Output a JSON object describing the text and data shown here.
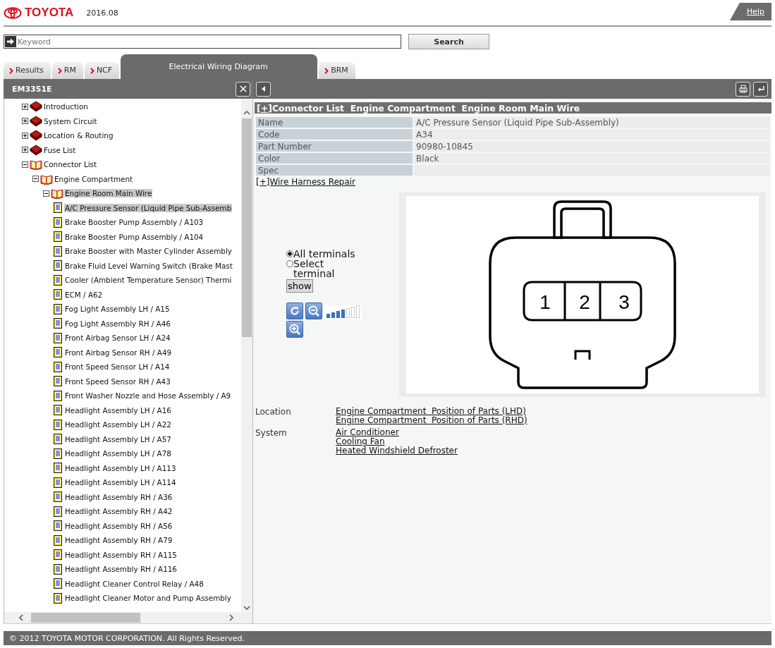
{
  "header": {
    "brand": "TOYOTA",
    "version": "2016.08",
    "help": "Help"
  },
  "search": {
    "placeholder": "Keyword",
    "button": "Search"
  },
  "tabs": [
    {
      "label": "Results",
      "selected": false
    },
    {
      "label": "RM",
      "selected": false
    },
    {
      "label": "NCF",
      "selected": false
    },
    {
      "label": "Electrical Wiring Diagram",
      "selected": true
    },
    {
      "label": "BRM",
      "selected": false
    }
  ],
  "left_panel": {
    "title": "EM3351E"
  },
  "tree": [
    {
      "label": "Introduction",
      "kind": "book",
      "expanded": false,
      "selected": false
    },
    {
      "label": "System Circuit",
      "kind": "book",
      "expanded": false,
      "selected": false
    },
    {
      "label": "Location & Routing",
      "kind": "book",
      "expanded": false,
      "selected": false
    },
    {
      "label": "Fuse List",
      "kind": "book",
      "expanded": false,
      "selected": false
    },
    {
      "label": "Connector List",
      "kind": "book",
      "expanded": true,
      "selected": false,
      "children": [
        {
          "label": "Engine Compartment",
          "kind": "book",
          "expanded": true,
          "selected": false,
          "children": [
            {
              "label": "Engine Room Main Wire",
              "kind": "book",
              "expanded": true,
              "selected": true,
              "children": [
                {
                  "label": "A/C Pressure Sensor (Liquid Pipe Sub-Assemb",
                  "kind": "page",
                  "selected": true
                },
                {
                  "label": "Brake Booster Pump Assembly / A103",
                  "kind": "page",
                  "selected": false
                },
                {
                  "label": "Brake Booster Pump Assembly / A104",
                  "kind": "page",
                  "selected": false
                },
                {
                  "label": "Brake Booster with Master Cylinder Assembly",
                  "kind": "page",
                  "selected": false
                },
                {
                  "label": "Brake Fluid Level Warning Switch (Brake Mast",
                  "kind": "page",
                  "selected": false
                },
                {
                  "label": "Cooler (Ambient Temperature Sensor) Thermi",
                  "kind": "page",
                  "selected": false
                },
                {
                  "label": "ECM / A62",
                  "kind": "page",
                  "selected": false
                },
                {
                  "label": "Fog Light Assembly LH / A15",
                  "kind": "page",
                  "selected": false
                },
                {
                  "label": "Fog Light Assembly RH / A46",
                  "kind": "page",
                  "selected": false
                },
                {
                  "label": "Front Airbag Sensor LH / A24",
                  "kind": "page",
                  "selected": false
                },
                {
                  "label": "Front Airbag Sensor RH / A49",
                  "kind": "page",
                  "selected": false
                },
                {
                  "label": "Front Speed Sensor LH / A14",
                  "kind": "page",
                  "selected": false
                },
                {
                  "label": "Front Speed Sensor RH / A43",
                  "kind": "page",
                  "selected": false
                },
                {
                  "label": "Front Washer Nozzle and Hose Assembly / A9",
                  "kind": "page",
                  "selected": false
                },
                {
                  "label": "Headlight Assembly LH / A16",
                  "kind": "page",
                  "selected": false
                },
                {
                  "label": "Headlight Assembly LH / A22",
                  "kind": "page",
                  "selected": false
                },
                {
                  "label": "Headlight Assembly LH / A57",
                  "kind": "page",
                  "selected": false
                },
                {
                  "label": "Headlight Assembly LH / A78",
                  "kind": "page",
                  "selected": false
                },
                {
                  "label": "Headlight Assembly LH / A113",
                  "kind": "page",
                  "selected": false
                },
                {
                  "label": "Headlight Assembly LH / A114",
                  "kind": "page",
                  "selected": false
                },
                {
                  "label": "Headlight Assembly RH / A36",
                  "kind": "page",
                  "selected": false
                },
                {
                  "label": "Headlight Assembly RH / A42",
                  "kind": "page",
                  "selected": false
                },
                {
                  "label": "Headlight Assembly RH / A56",
                  "kind": "page",
                  "selected": false
                },
                {
                  "label": "Headlight Assembly RH / A79",
                  "kind": "page",
                  "selected": false
                },
                {
                  "label": "Headlight Assembly RH / A115",
                  "kind": "page",
                  "selected": false
                },
                {
                  "label": "Headlight Assembly RH / A116",
                  "kind": "page",
                  "selected": false
                },
                {
                  "label": "Headlight Cleaner Control Relay / A48",
                  "kind": "page",
                  "selected": false
                },
                {
                  "label": "Headlight Cleaner Motor and Pump Assembly",
                  "kind": "page",
                  "selected": false
                }
              ]
            }
          ]
        }
      ]
    }
  ],
  "content": {
    "toggle": "[+]",
    "title": "Connector List  Engine Compartment  Engine Room Main Wire",
    "properties": [
      {
        "label": "Name",
        "value": "A/C Pressure Sensor (Liquid Pipe Sub-Assembly)"
      },
      {
        "label": "Code",
        "value": "A34"
      },
      {
        "label": "Part Number",
        "value": "90980-10845"
      },
      {
        "label": "Color",
        "value": "Black"
      },
      {
        "label": "Spec"
      }
    ],
    "repair_link": "[+]Wire Harness Repair",
    "terminal_options": [
      {
        "label": "All terminals",
        "selected": true
      },
      {
        "label": "Select terminal",
        "selected": false
      }
    ],
    "show_button": "show",
    "zoom": {
      "level": 0.57
    },
    "pins": [
      "1",
      "2",
      "3"
    ],
    "links": [
      {
        "label": "Location",
        "items": [
          "Engine Compartment  Position of Parts (LHD)",
          "Engine Compartment  Position of Parts (RHD)"
        ]
      },
      {
        "label": "System",
        "items": [
          "Air Conditioner",
          "Cooling Fan",
          "Heated Windshield Defroster"
        ]
      }
    ]
  },
  "footer": "© 2012 TOYOTA MOTOR CORPORATION. All Rights Reserved."
}
